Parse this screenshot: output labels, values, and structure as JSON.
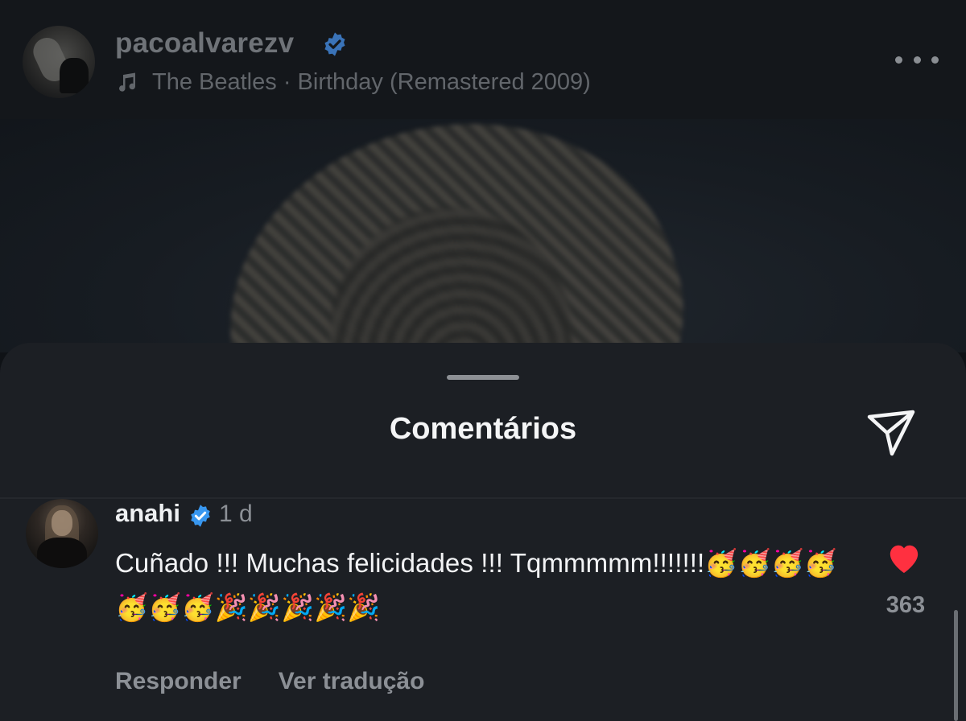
{
  "post": {
    "username": "pacoalvarezv",
    "song": "The Beatles · Birthday (Remastered 2009)",
    "icons": [
      "verified-badge-icon",
      "music-note-icon",
      "more-options-icon"
    ]
  },
  "comments_sheet": {
    "title": "Comentários",
    "share_icon": "send-icon"
  },
  "comment": {
    "username": "anahi",
    "time": "1 d",
    "text": "Cuñado !!! Muchas felicidades !!! Tqmmmmm!!!!!!!🥳🥳🥳🥳🥳🥳🥳🎉🎉🎉🎉🎉",
    "likes": "363",
    "reply_label": "Responder",
    "translate_label": "Ver tradução",
    "icons": [
      "verified-badge-icon",
      "heart-filled-icon"
    ]
  },
  "colors": {
    "verified": "#3897f0",
    "like": "#ff3040",
    "sheet_bg": "#1c1f24",
    "header_bg": "#14171b"
  }
}
